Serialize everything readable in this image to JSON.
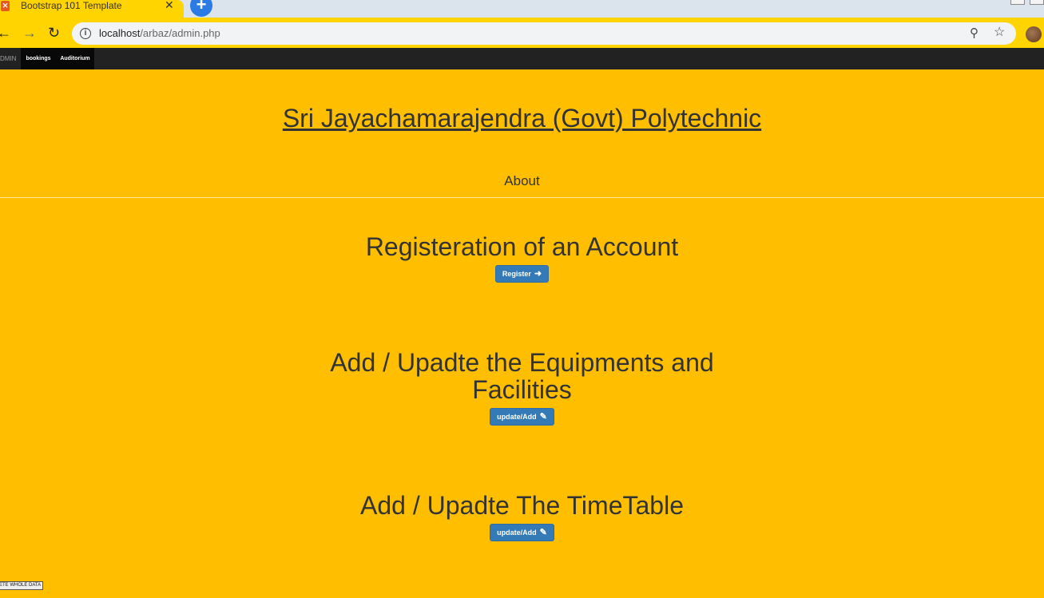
{
  "browser": {
    "tab_title": "Bootstrap 101 Template",
    "tab_close": "✕",
    "new_tab": "+",
    "url_host": "localhost",
    "url_path": "/arbaz/admin.php",
    "icons": {
      "back": "back-arrow-icon",
      "forward": "forward-arrow-icon",
      "reload": "reload-icon",
      "info": "info-icon",
      "zoom": "zoom-icon",
      "star": "star-icon",
      "profile": "profile-avatar"
    }
  },
  "navbar": {
    "brand": "DMIN",
    "items": [
      {
        "label": "bookings"
      },
      {
        "label": "Auditorium"
      }
    ]
  },
  "page": {
    "title": "Sri Jayachamarajendra (Govt) Polytechnic",
    "about": "About"
  },
  "sections": [
    {
      "heading": "Registeration of an Account",
      "button": "Register",
      "button_icon": "arrow-right-icon"
    },
    {
      "heading": "Add / Upadte the Equipments and Facilities",
      "button": "update/Add",
      "button_icon": "pencil-icon"
    },
    {
      "heading": "Add / Upadte The TimeTable",
      "button": "update/Add",
      "button_icon": "pencil-icon"
    }
  ],
  "footer": {
    "delete_button": "ETE WHOLE DATA"
  },
  "colors": {
    "page_background": "#ffbf00",
    "navbar": "#222222",
    "button": "#337ab7",
    "tab_accent": "#ffd400"
  }
}
